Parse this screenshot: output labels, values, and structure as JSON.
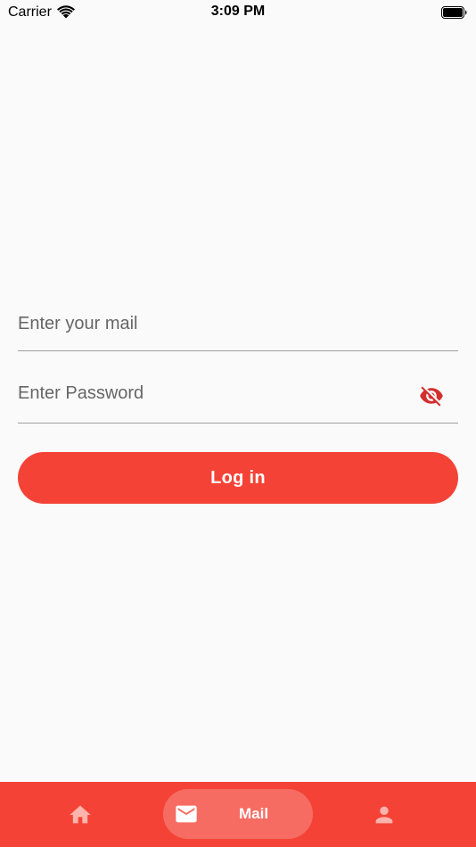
{
  "status_bar": {
    "carrier": "Carrier",
    "time": "3:09 PM",
    "icons": [
      "wifi-icon",
      "battery-icon"
    ]
  },
  "form": {
    "email": {
      "value": "",
      "placeholder": "Enter your mail"
    },
    "password": {
      "value": "",
      "placeholder": "Enter Password",
      "visibility_icon": "eye-off-icon"
    },
    "login_label": "Log in"
  },
  "bottom_nav": {
    "items": [
      {
        "icon": "home-icon",
        "label": "",
        "active": false
      },
      {
        "icon": "mail-icon",
        "label": "Mail",
        "active": true
      },
      {
        "icon": "person-icon",
        "label": "",
        "active": false
      }
    ]
  },
  "colors": {
    "accent": "#f44336",
    "icon_accent": "#d32f2f",
    "background": "#fafafa",
    "inactive_nav_icon": "#ffb3ad"
  }
}
